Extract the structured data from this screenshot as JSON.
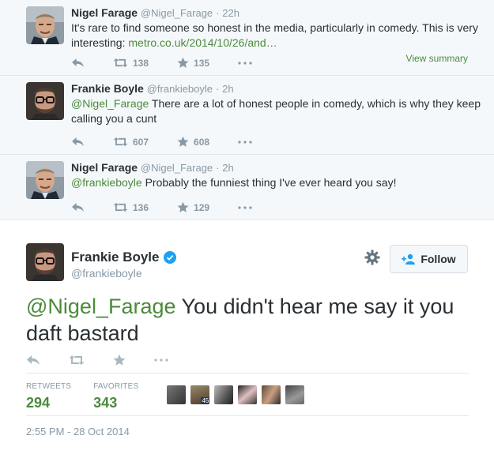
{
  "thread": [
    {
      "name": "Nigel Farage",
      "handle": "@Nigel_Farage",
      "sep": "·",
      "time": "22h",
      "text": "It's rare to find someone so honest in the media, particularly in comedy. This is very interesting: ",
      "link": "metro.co.uk/2014/10/26/and…",
      "retweets": "138",
      "favorites": "135",
      "view_summary": "View summary",
      "avatar": "nigel"
    },
    {
      "name": "Frankie Boyle",
      "handle": "@frankieboyle",
      "sep": "·",
      "time": "2h",
      "mention": "@Nigel_Farage",
      "text": " There are a lot of honest people in comedy, which is why they keep calling you a cunt",
      "retweets": "607",
      "favorites": "608",
      "avatar": "frankie"
    },
    {
      "name": "Nigel Farage",
      "handle": "@Nigel_Farage",
      "sep": "·",
      "time": "2h",
      "mention": "@frankieboyle",
      "text": " Probably the funniest thing I've ever heard you say!",
      "retweets": "136",
      "favorites": "129",
      "avatar": "nigel"
    }
  ],
  "main": {
    "name": "Frankie Boyle",
    "handle": "@frankieboyle",
    "follow_label": "Follow",
    "mention": "@Nigel_Farage",
    "text": " You didn't hear me say it you daft bastard",
    "retweets_label": "RETWEETS",
    "retweets_value": "294",
    "favorites_label": "FAVORITES",
    "favorites_value": "343",
    "face_badge": "45",
    "date": "2:55 PM - 28 Oct 2014"
  },
  "icons": [
    "reply-icon",
    "retweet-icon",
    "favorite-icon",
    "more-icon",
    "gear-icon",
    "follow-person-icon",
    "verified-icon"
  ],
  "colors": {
    "link": "#4b8a3b",
    "muted": "#8899a6",
    "verified": "#1da1f2",
    "thread_bg": "#f5f8fa"
  }
}
